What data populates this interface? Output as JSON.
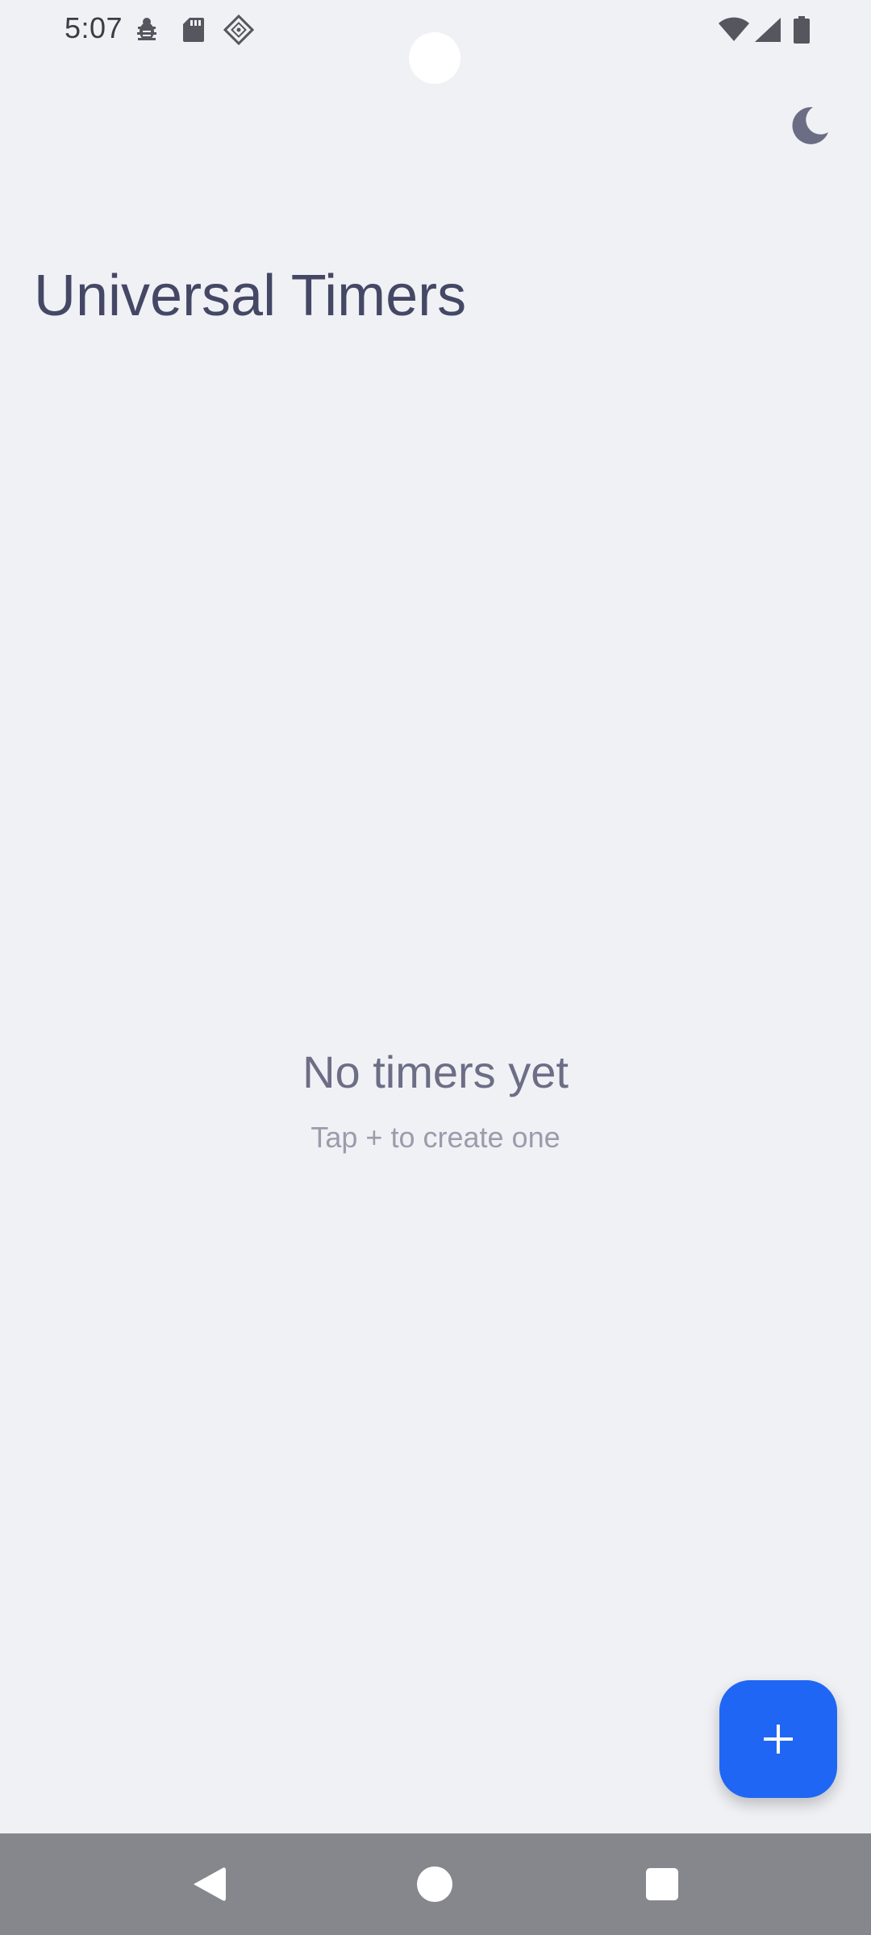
{
  "status_bar": {
    "time": "5:07",
    "left_icons": [
      "bug-icon",
      "sd-card-icon",
      "location-diamond-icon"
    ],
    "right_icons": [
      "wifi-icon",
      "signal-icon",
      "battery-icon"
    ]
  },
  "header": {
    "title": "Universal Timers",
    "theme_toggle_icon": "moon-icon"
  },
  "empty_state": {
    "title": "No timers yet",
    "subtitle": "Tap + to create one"
  },
  "fab": {
    "icon": "plus-icon",
    "color": "#2066f5"
  },
  "navigation": {
    "buttons": [
      "back-icon",
      "home-icon",
      "recents-icon"
    ]
  },
  "colors": {
    "background": "#f0f1f5",
    "title": "#444865",
    "accent": "#2066f5",
    "nav_bar": "#86878c"
  }
}
